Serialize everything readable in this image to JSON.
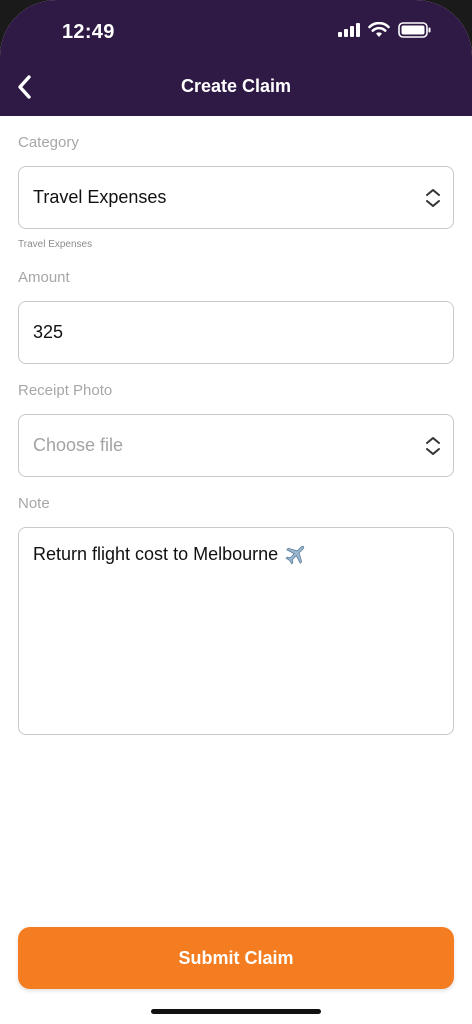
{
  "status_bar": {
    "time": "12:49"
  },
  "nav": {
    "title": "Create Claim"
  },
  "form": {
    "category": {
      "label": "Category",
      "value": "Travel Expenses",
      "helper": "Travel Expenses"
    },
    "amount": {
      "label": "Amount",
      "value": "325"
    },
    "receipt": {
      "label": "Receipt Photo",
      "placeholder": "Choose file"
    },
    "note": {
      "label": "Note",
      "value": "Return flight cost to Melbourne"
    }
  },
  "actions": {
    "submit_label": "Submit Claim"
  },
  "colors": {
    "header": "#2e1a44",
    "accent": "#f47d22"
  }
}
